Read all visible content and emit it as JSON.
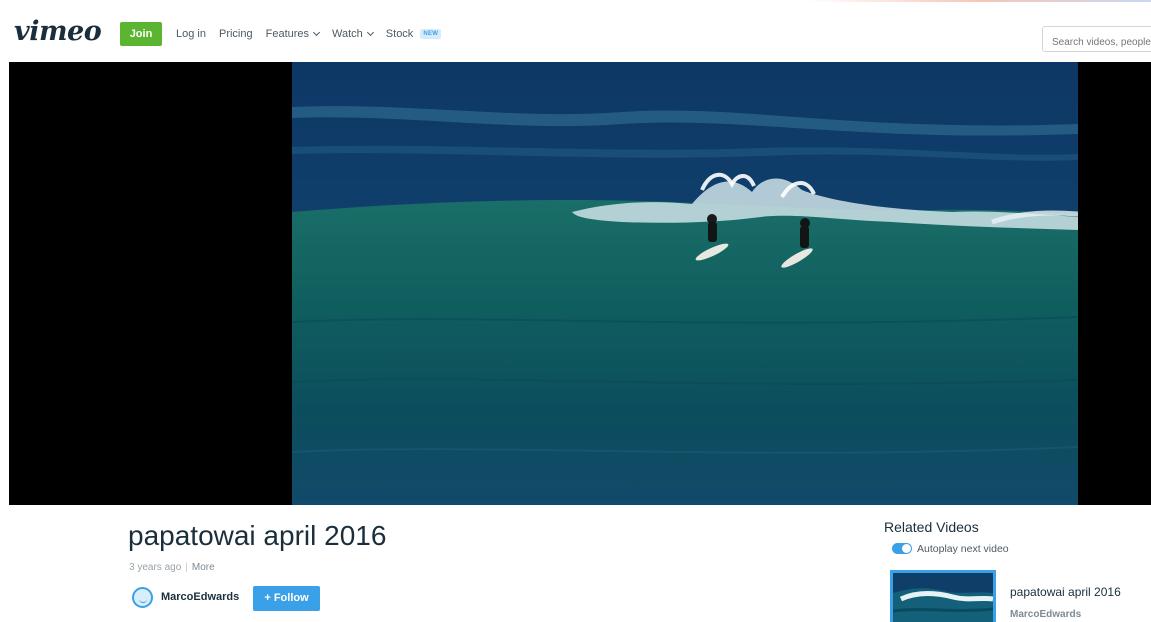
{
  "header": {
    "logo": "vimeo",
    "join_label": "Join",
    "nav": [
      {
        "label": "Log in",
        "has_dropdown": false
      },
      {
        "label": "Pricing",
        "has_dropdown": false
      },
      {
        "label": "Features",
        "has_dropdown": true
      },
      {
        "label": "Watch",
        "has_dropdown": true
      },
      {
        "label": "Stock",
        "has_dropdown": false,
        "badge": "NEW"
      }
    ],
    "search_placeholder": "Search videos, people"
  },
  "video": {
    "title": "papatowai april 2016",
    "age": "3 years ago",
    "more_label": "More",
    "author": "MarcoEdwards",
    "follow_label": "+ Follow"
  },
  "related": {
    "heading": "Related Videos",
    "autoplay_label": "Autoplay next video",
    "autoplay_on": true,
    "items": [
      {
        "title": "papatowai april 2016",
        "author": "MarcoEdwards"
      }
    ]
  },
  "colors": {
    "brand_text": "#1a2e3b",
    "join_green": "#5cb531",
    "accent_blue": "#3aa0e8"
  }
}
